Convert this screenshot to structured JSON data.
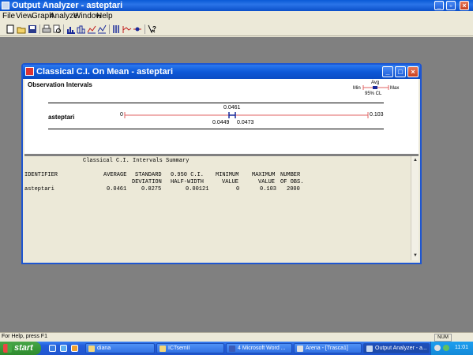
{
  "app": {
    "title": "Output Analyzer - asteptari"
  },
  "menu": [
    "File",
    "View",
    "Graph",
    "Analyze",
    "Window",
    "Help"
  ],
  "toolbar_icons": [
    "new-icon",
    "open-icon",
    "save-icon",
    "print-icon",
    "print-preview-icon",
    "bar-chart-icon",
    "histogram-icon",
    "line-plot-icon",
    "correlogram-icon",
    "interval-icon",
    "moving-average-icon",
    "point-icon",
    "context-help-icon"
  ],
  "child": {
    "title": "Classical C.I. On Mean - asteptari",
    "plot": {
      "section_title": "Observation Intervals",
      "legend": {
        "avg": "Avg",
        "min": "Min",
        "max": "Max",
        "cl": "95% CL"
      },
      "series_label": "asteptari",
      "min_label": "0",
      "max_label": "0.103",
      "avg_label": "0.0461",
      "lower_label": "0.0449",
      "upper_label": "0.0473"
    },
    "summary": {
      "title": "Classical C.I. Intervals Summary",
      "headers_line1": [
        "IDENTIFIER",
        "AVERAGE",
        "STANDARD",
        "0.950 C.I.",
        "MINIMUM",
        "MAXIMUM",
        "NUMBER"
      ],
      "headers_line2": [
        "",
        "",
        "DEVIATION",
        "HALF-WIDTH",
        "VALUE",
        "VALUE",
        "OF OBS."
      ],
      "rows": [
        {
          "identifier": "asteptari",
          "average": "0.0461",
          "std_dev": "0.0275",
          "half_width": "0.00121",
          "min": "0",
          "max": "0.103",
          "n": "2000"
        }
      ]
    }
  },
  "status": {
    "help_text": "For Help, press F1",
    "num": "NUM"
  },
  "taskbar": {
    "start": "start",
    "tasks": [
      "diana",
      "ICTsemII",
      "4 Microsoft Word ...",
      "Arena - [Trasca1]",
      "Output Analyzer - a..."
    ],
    "clock": "11:01"
  },
  "colors": {
    "interval_line": "#e06060",
    "titlebar": "#0a5ad6",
    "mdi_background": "#808080",
    "marker": "#1a2a9a"
  }
}
